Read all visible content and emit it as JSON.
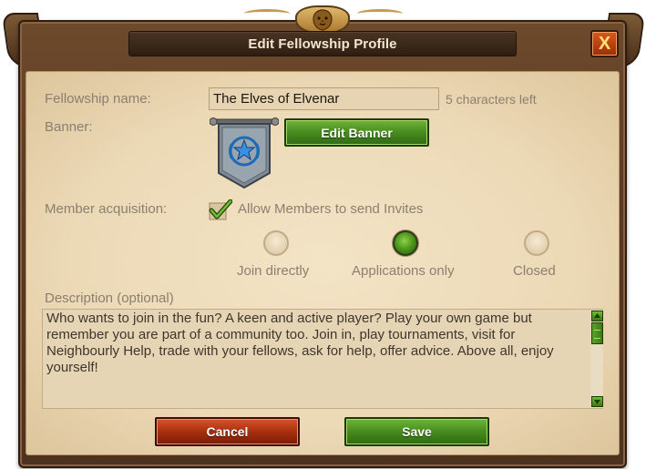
{
  "dialog": {
    "title": "Edit Fellowship Profile",
    "close_label": "X"
  },
  "form": {
    "name_label": "Fellowship name:",
    "name_value": "The Elves of Elvenar",
    "name_counter": "5 characters left",
    "banner_label": "Banner:",
    "edit_banner_label": "Edit Banner",
    "acquisition_label": "Member acquisition:",
    "allow_invites_label": "Allow Members to send Invites",
    "allow_invites_checked": true,
    "acquisition_options": [
      {
        "label": "Join directly",
        "selected": false
      },
      {
        "label": "Applications only",
        "selected": true
      },
      {
        "label": "Closed",
        "selected": false
      }
    ],
    "description_label": "Description (optional)",
    "description_value": "Who wants to join in the fun? A keen and active player? Play your own game but remember you are part of a community too. Join in, play tournaments, visit for Neighbourly Help, trade with your fellows, ask for help, offer advice. Above all, enjoy yourself!"
  },
  "actions": {
    "cancel_label": "Cancel",
    "save_label": "Save"
  },
  "colors": {
    "accent_green": "#4a8f20",
    "cancel_red": "#a8300f",
    "title_text": "#f3e6cf",
    "parchment": "#ecd9b6",
    "frame_wood": "#5a3a22"
  },
  "icons": {
    "crest": "lion-crest-icon",
    "close": "close-icon",
    "check": "checkmark-icon",
    "banner": "banner-emblem-icon",
    "scroll_up": "arrow-up-icon",
    "scroll_down": "arrow-down-icon"
  }
}
